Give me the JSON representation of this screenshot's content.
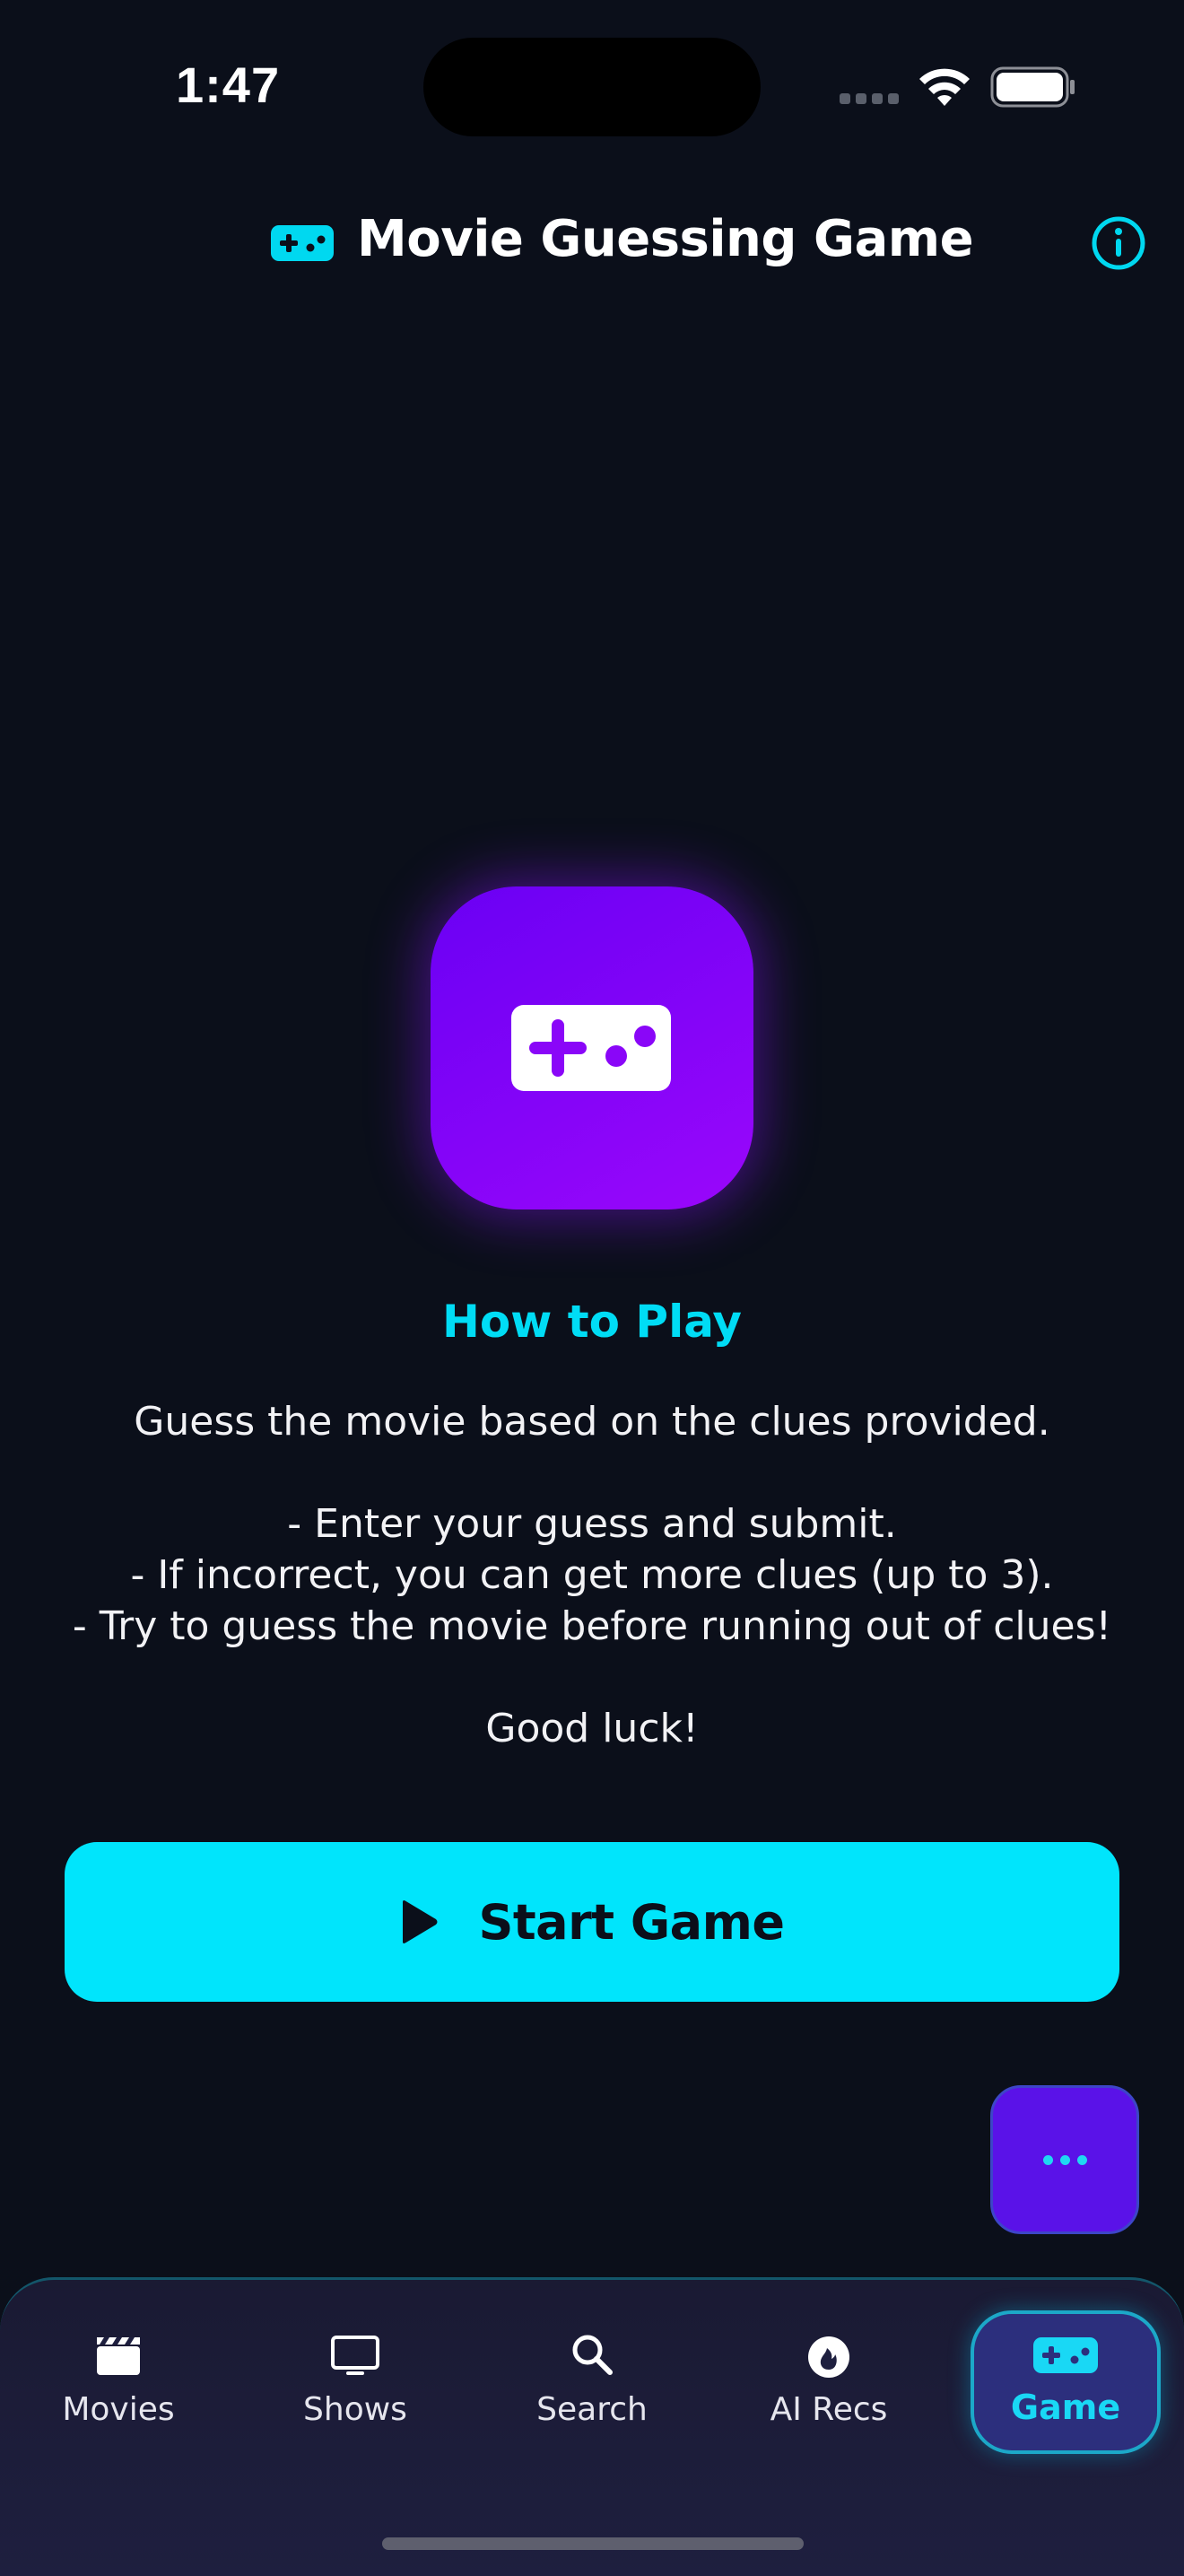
{
  "status_bar": {
    "time": "1:47"
  },
  "header": {
    "title": "Movie Guessing Game",
    "icon": "gamecontroller-icon",
    "info_icon": "info-circle-icon"
  },
  "hero": {
    "icon": "gamecontroller-icon"
  },
  "instructions": {
    "title": "How to Play",
    "intro": "Guess the movie based on the clues provided.",
    "steps": [
      "- Enter your guess and submit.",
      "- If incorrect, you can get more clues (up to 3).",
      "- Try to guess the movie before running out of clues!"
    ],
    "closing": "Good luck!"
  },
  "start_button": {
    "label": "Start Game",
    "icon": "play-icon"
  },
  "fab": {
    "icon": "more-dots-icon"
  },
  "tabs": [
    {
      "label": "Movies",
      "icon": "clapperboard-icon",
      "active": false
    },
    {
      "label": "Shows",
      "icon": "tv-icon",
      "active": false
    },
    {
      "label": "Search",
      "icon": "search-icon",
      "active": false
    },
    {
      "label": "AI Recs",
      "icon": "flame-icon",
      "active": false
    },
    {
      "label": "Game",
      "icon": "gamecontroller-icon",
      "active": true
    }
  ],
  "colors": {
    "background": "#0b0f1a",
    "accent_cyan": "#00e5fc",
    "accent_purple": "#8a06f8",
    "tab_bar": "#1e1f3f"
  }
}
